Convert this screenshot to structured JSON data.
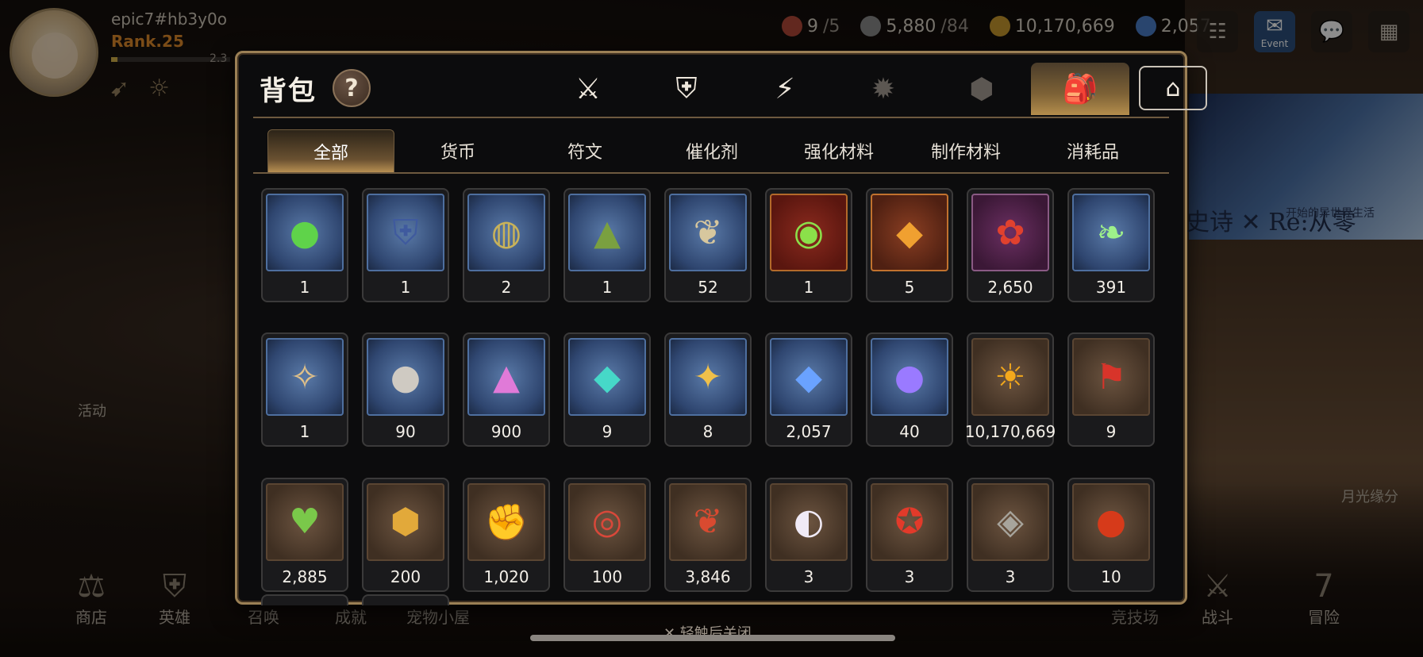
{
  "user": {
    "name": "epic7#hb3y0o",
    "rank": "Rank.25",
    "exp_text": "2.3",
    "exp_fraction": 0.05
  },
  "resources": [
    {
      "icon": "stamina-icon",
      "value": "9",
      "sub": "/5",
      "color": "#b24a3a"
    },
    {
      "icon": "skystone-icon",
      "value": "5,880",
      "sub": "/84",
      "color": "#8a8a8a"
    },
    {
      "icon": "gold-icon",
      "value": "10,170,669",
      "sub": "",
      "color": "#c89a2e"
    },
    {
      "icon": "crystal-icon",
      "value": "2,057",
      "sub": "",
      "color": "#4b7fc9"
    }
  ],
  "top_buttons": [
    {
      "name": "friends-button",
      "glyph": "☷",
      "label": ""
    },
    {
      "name": "mail-event-button",
      "glyph": "✉",
      "label": "Event"
    },
    {
      "name": "chat-button",
      "glyph": "💬",
      "label": ""
    },
    {
      "name": "menu-button",
      "glyph": "▦",
      "label": ""
    }
  ],
  "banner": {
    "title": "史诗 ✕ Re:从零",
    "subtitle": "开始的异世界生活"
  },
  "side_labels": {
    "activity": "活动",
    "moonlight": "月光缘分"
  },
  "bottom_nav": [
    {
      "name": "nav-shop",
      "glyph": "⚖",
      "label": "商店"
    },
    {
      "name": "nav-hero",
      "glyph": "⛨",
      "label": "英雄"
    },
    {
      "name": "nav-summon",
      "glyph": "",
      "label": "召唤"
    },
    {
      "name": "nav-achievement",
      "glyph": "",
      "label": "成就"
    },
    {
      "name": "nav-pet-house",
      "glyph": "",
      "label": "宠物小屋"
    },
    {
      "name": "nav-arena",
      "glyph": "",
      "label": "竞技场"
    },
    {
      "name": "nav-battle",
      "glyph": "⚔",
      "label": "战斗"
    },
    {
      "name": "nav-adventure",
      "glyph": "7",
      "label": "冒险"
    }
  ],
  "panel": {
    "title": "背包",
    "help": "?",
    "close_hint": "✕ 轻触后关闭",
    "category_tabs": [
      {
        "name": "weapon-tab",
        "glyph": "⚔"
      },
      {
        "name": "armor-tab",
        "glyph": "⛨"
      },
      {
        "name": "artifact-tab",
        "glyph": "⚡"
      },
      {
        "name": "special-tab",
        "glyph": "✹"
      },
      {
        "name": "cube-tab",
        "glyph": "⬢"
      },
      {
        "name": "bag-tab",
        "glyph": "🎒"
      },
      {
        "name": "storage-tab",
        "glyph": "⌂"
      }
    ],
    "sub_tabs": [
      "全部",
      "货币",
      "符文",
      "催化剂",
      "强化材料",
      "制作材料",
      "消耗品"
    ],
    "items": [
      {
        "icon": "slime-orbs-icon",
        "glyph": "●",
        "color": "#5fd34a",
        "frame": "blue",
        "count": "1"
      },
      {
        "icon": "shield-trident-icon",
        "glyph": "⛨",
        "color": "#3f5a9e",
        "frame": "blue",
        "count": "1"
      },
      {
        "icon": "rune-ring-icon",
        "glyph": "◍",
        "color": "#c8b25a",
        "frame": "blue",
        "count": "2"
      },
      {
        "icon": "green-powder-icon",
        "glyph": "▲",
        "color": "#7aa040",
        "frame": "blue",
        "count": "1"
      },
      {
        "icon": "root-herb-icon",
        "glyph": "❦",
        "color": "#d7c79e",
        "frame": "blue",
        "count": "52"
      },
      {
        "icon": "green-orb-icon",
        "glyph": "◉",
        "color": "#8be04a",
        "frame": "green",
        "count": "1"
      },
      {
        "icon": "amber-crystal-icon",
        "glyph": "◆",
        "color": "#f0a030",
        "frame": "orange",
        "count": "5"
      },
      {
        "icon": "red-flower-ring-icon",
        "glyph": "✿",
        "color": "#e0412e",
        "frame": "purple",
        "count": "2,650"
      },
      {
        "icon": "green-leaf-icon",
        "glyph": "❧",
        "color": "#9ef08a",
        "frame": "blue",
        "count": "391"
      },
      {
        "icon": "compass-charm-icon",
        "glyph": "✧",
        "color": "#e2c188",
        "frame": "blue",
        "count": "1"
      },
      {
        "icon": "silver-coin-icon",
        "glyph": "●",
        "color": "#cfcac2",
        "frame": "blue",
        "count": "90"
      },
      {
        "icon": "pink-mountain-icon",
        "glyph": "▲",
        "color": "#e07ad8",
        "frame": "blue",
        "count": "900"
      },
      {
        "icon": "teal-crystal-icon",
        "glyph": "◆",
        "color": "#46d8c8",
        "frame": "blue",
        "count": "9"
      },
      {
        "icon": "star-pendant-icon",
        "glyph": "✦",
        "color": "#f0c04a",
        "frame": "blue",
        "count": "8"
      },
      {
        "icon": "blue-gem-icon",
        "glyph": "◆",
        "color": "#6aa2ff",
        "frame": "blue",
        "count": "2,057"
      },
      {
        "icon": "purple-orb-icon",
        "glyph": "●",
        "color": "#9a7aff",
        "frame": "blue",
        "count": "40"
      },
      {
        "icon": "gold-sun-coin-icon",
        "glyph": "☀",
        "color": "#f3a81c",
        "frame": "brown",
        "count": "10,170,669"
      },
      {
        "icon": "red-banner-icon",
        "glyph": "⚑",
        "color": "#d8342a",
        "frame": "brown",
        "count": "9"
      },
      {
        "icon": "green-heart-icon",
        "glyph": "♥",
        "color": "#7ac84a",
        "frame": "brown",
        "count": "2,885"
      },
      {
        "icon": "gold-shield-emblem-icon",
        "glyph": "⬢",
        "color": "#e2a93a",
        "frame": "brown",
        "count": "200"
      },
      {
        "icon": "fist-emblem-icon",
        "glyph": "✊",
        "color": "#e0a040",
        "frame": "brown",
        "count": "1,020"
      },
      {
        "icon": "red-bracelet-icon",
        "glyph": "◎",
        "color": "#d8483a",
        "frame": "brown",
        "count": "100"
      },
      {
        "icon": "red-leaf-icon",
        "glyph": "❦",
        "color": "#d94a30",
        "frame": "brown",
        "count": "3,846"
      },
      {
        "icon": "white-pet-icon",
        "glyph": "◐",
        "color": "#f0eaf6",
        "frame": "brown",
        "count": "3"
      },
      {
        "icon": "red-badge-icon",
        "glyph": "✪",
        "color": "#e23a2a",
        "frame": "brown",
        "count": "3"
      },
      {
        "icon": "stone-rune-icon",
        "glyph": "◈",
        "color": "#a7a49c",
        "frame": "brown",
        "count": "3"
      },
      {
        "icon": "lava-orb-icon",
        "glyph": "●",
        "color": "#d63a1a",
        "frame": "brown",
        "count": "10"
      }
    ]
  },
  "colors": {
    "accent_gold": "#b48d4c",
    "panel_border": "#9b8055",
    "rank": "#e08a2a"
  }
}
